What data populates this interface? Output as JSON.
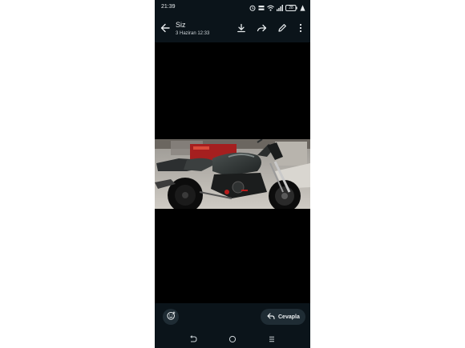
{
  "status_bar": {
    "time": "21:39",
    "battery": "28",
    "icons": [
      "alarm-icon",
      "data-speed-icon",
      "wifi-icon",
      "signal-icon",
      "battery-icon",
      "notification-icon"
    ]
  },
  "header": {
    "title": "Siz",
    "subtitle": "3 Haziran 12:33",
    "actions": [
      "back-arrow-icon",
      "download-icon",
      "forward-icon",
      "edit-icon",
      "more-icon"
    ]
  },
  "footer": {
    "reply_label": "Cevapla",
    "emoji_icon": "emoji-reaction-icon"
  },
  "nav": [
    "back-icon",
    "home-icon",
    "recents-icon"
  ],
  "colors": {
    "bar_bg": "#0b141a",
    "button_bg": "#1f2c34",
    "text": "#e9edef",
    "image_bg": "#000000"
  }
}
